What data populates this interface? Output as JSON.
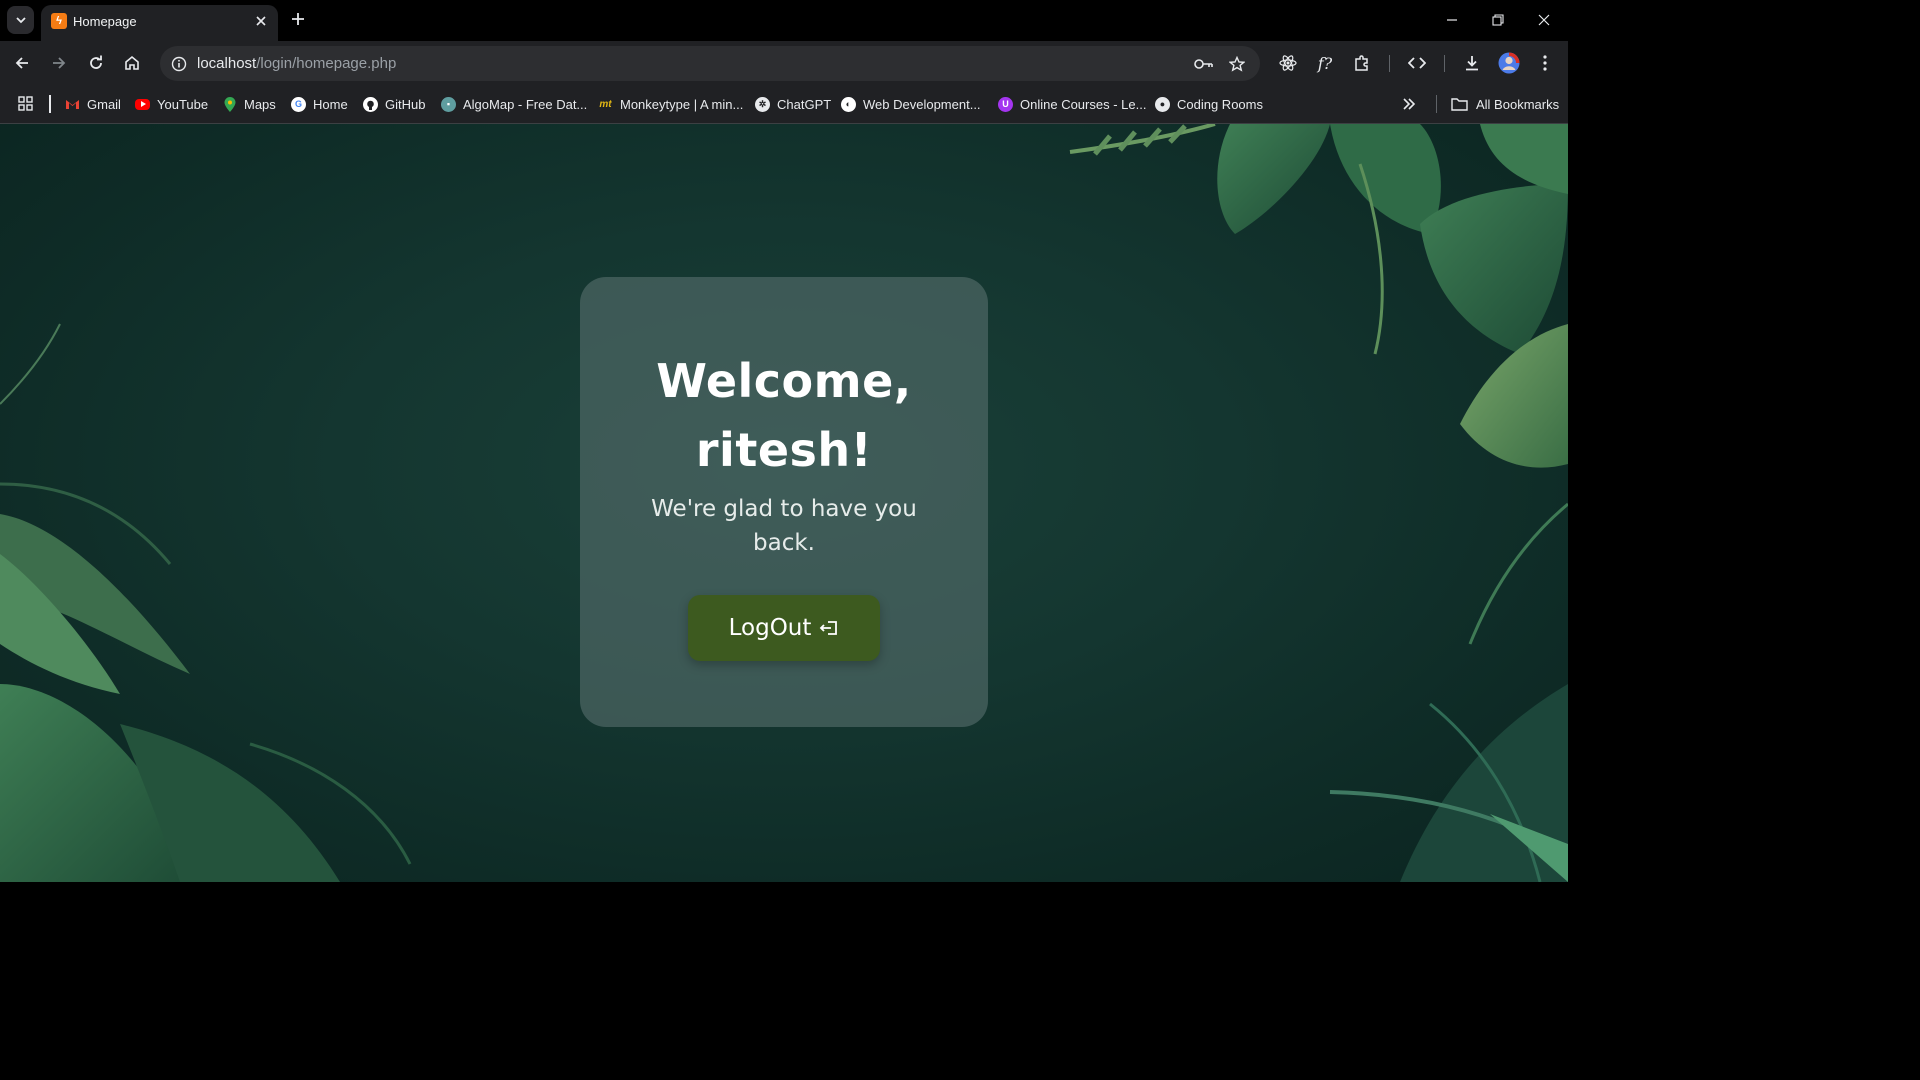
{
  "browser": {
    "tab": {
      "title": "Homepage",
      "favicon": "xampp-icon"
    },
    "url": {
      "host": "localhost",
      "path": "/login/homepage.php"
    },
    "bookmarks": [
      {
        "label": "Gmail",
        "icon": "gmail-icon",
        "color": "#ea4335"
      },
      {
        "label": "YouTube",
        "icon": "youtube-icon",
        "color": "#ff0000"
      },
      {
        "label": "Maps",
        "icon": "maps-icon",
        "color": "#34a853"
      },
      {
        "label": "Home",
        "icon": "google-icon",
        "color": "#4285f4"
      },
      {
        "label": "GitHub",
        "icon": "github-icon",
        "color": "#ffffff"
      },
      {
        "label": "AlgoMap - Free Dat...",
        "icon": "algomap-icon",
        "color": "#5f9ea0"
      },
      {
        "label": "Monkeytype | A min...",
        "icon": "monkeytype-icon",
        "color": "#e2b714"
      },
      {
        "label": "ChatGPT",
        "icon": "chatgpt-icon",
        "color": "#ffffff"
      },
      {
        "label": "Web Development...",
        "icon": "webdev-icon",
        "color": "#f5c518"
      },
      {
        "label": "Online Courses - Le...",
        "icon": "courses-icon",
        "color": "#a435f0"
      },
      {
        "label": "Coding Rooms",
        "icon": "codingrooms-icon",
        "color": "#e8eaed"
      }
    ],
    "all_bookmarks_label": "All Bookmarks"
  },
  "page": {
    "welcome_line1": "Welcome,",
    "welcome_line2": "ritesh!",
    "subtitle": "We're glad to have you back.",
    "logout_label": "LogOut",
    "logout_icon": "logout-icon",
    "colors": {
      "card": "#4e6866",
      "button": "#3d5a1f",
      "background": "#143630"
    }
  }
}
